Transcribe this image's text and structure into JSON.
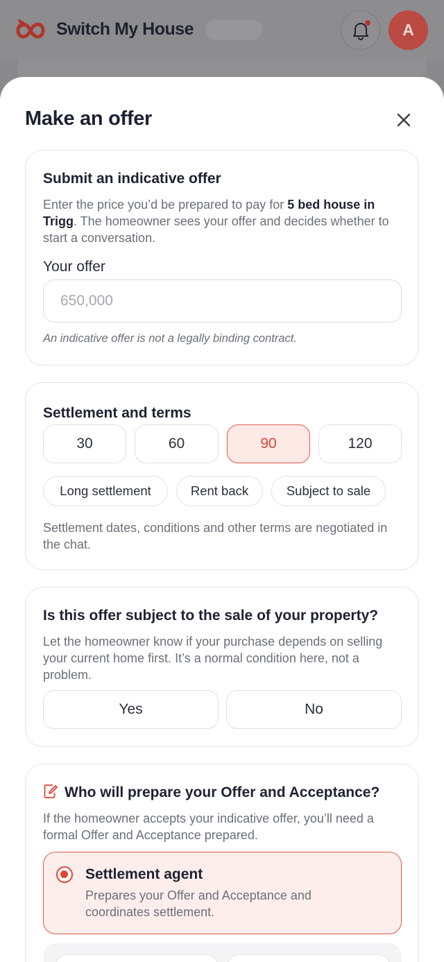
{
  "header": {
    "brand": "Switch My House",
    "avatar_initial": "A",
    "brand_color": "#c8372b"
  },
  "sheet": {
    "title": "Make an offer"
  },
  "offer_card": {
    "title": "Submit an indicative offer",
    "desc_prefix": "Enter the price you’d be prepared to pay for ",
    "desc_property": "5 bed house in Trigg",
    "desc_suffix": ". The homeowner sees your offer and decides whether to start a conversation.",
    "offer_label": "Your offer",
    "offer_placeholder": "650,000",
    "offer_value": "",
    "note": "An indicative offer is not a legally binding contract."
  },
  "settlement_card": {
    "title": "Settlement and terms",
    "days": [
      {
        "label": "30",
        "selected": false
      },
      {
        "label": "60",
        "selected": false
      },
      {
        "label": "90",
        "selected": true
      },
      {
        "label": "120",
        "selected": false
      }
    ],
    "terms": [
      "Long settlement",
      "Rent back",
      "Subject to sale"
    ],
    "desc": "Settlement dates, conditions and other terms are negotiated in the chat."
  },
  "subject_card": {
    "title": "Is this offer subject to the sale of your property?",
    "desc": "Let the homeowner know if your purchase depends on selling your current home first. It’s a normal condition here, not a problem.",
    "yes_label": "Yes",
    "no_label": "No"
  },
  "prepare_card": {
    "title": "Who will prepare your Offer and Acceptance?",
    "desc": "If the homeowner accepts your indicative offer, you’ll need a formal Offer and Acceptance prepared.",
    "options": [
      {
        "title": "Settlement agent",
        "desc": "Prepares your Offer and Acceptance and coordinates settlement.",
        "selected": true
      }
    ]
  },
  "colors": {
    "accent": "#df4634",
    "accent_bg": "#fde9e6",
    "text": "#1d2230",
    "muted": "#6b6f78"
  }
}
